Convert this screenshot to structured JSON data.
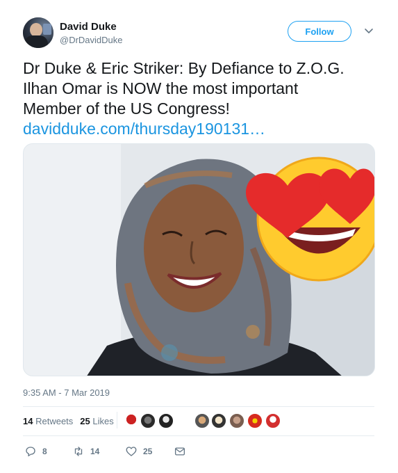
{
  "author": {
    "display_name": "David Duke",
    "handle": "@DrDavidDuke"
  },
  "follow_button": {
    "label": "Follow"
  },
  "tweet": {
    "text_lines": [
      "Dr Duke & Eric Striker: By Defiance to Z.O.G.",
      "Ilhan Omar is NOW the most important",
      "Member of the US Congress!"
    ],
    "link_text": "davidduke.com/thursday190131…"
  },
  "timestamp": "9:35 AM - 7 Mar 2019",
  "stats": {
    "retweets_count": "14",
    "retweets_label": "Retweets",
    "likes_count": "25",
    "likes_label": "Likes"
  },
  "actions": {
    "reply_count": "8",
    "retweet_count": "14",
    "like_count": "25"
  },
  "colors": {
    "brand": "#1da1f2",
    "link": "#1b95e0",
    "muted": "#657786"
  }
}
